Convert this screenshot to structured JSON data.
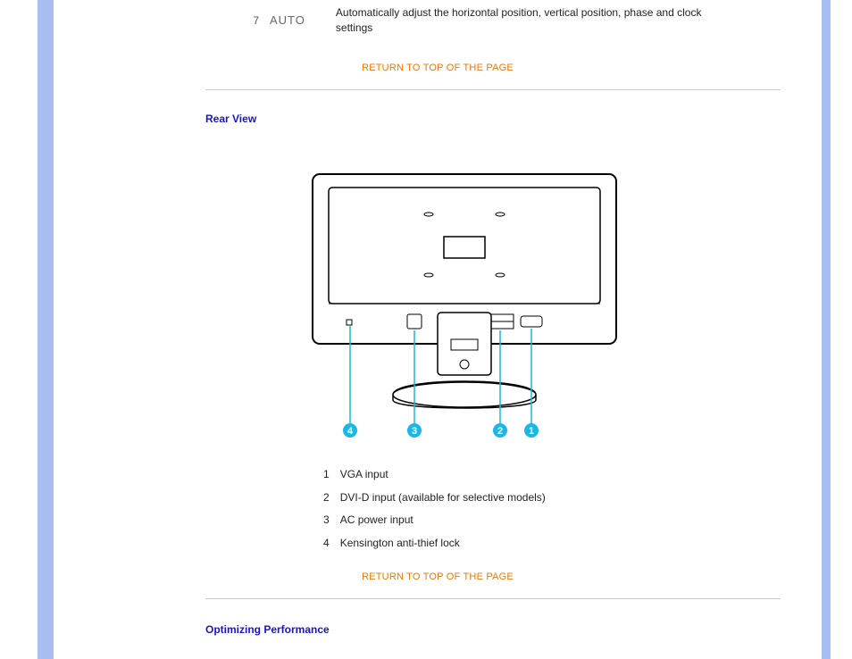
{
  "row7": {
    "num": "7",
    "auto": "AUTO",
    "desc": "Automatically adjust the horizontal position, vertical position, phase and clock settings"
  },
  "return_label": "RETURN TO TOP OF THE PAGE",
  "sections": {
    "rear": "Rear View",
    "opt": "Optimizing Performance"
  },
  "legend": {
    "1": {
      "n": "1",
      "t": "VGA input"
    },
    "2": {
      "n": "2",
      "t": "DVI-D input (available for selective models)"
    },
    "3": {
      "n": "3",
      "t": "AC power input"
    },
    "4": {
      "n": "4",
      "t": "Kensington anti-thief lock"
    }
  },
  "callouts": {
    "a": "4",
    "b": "3",
    "c": "2",
    "d": "1"
  }
}
